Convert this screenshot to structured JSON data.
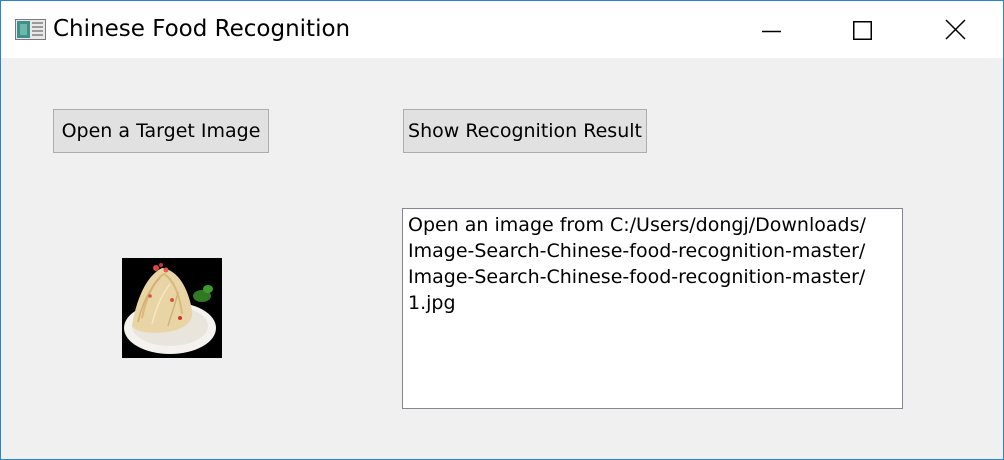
{
  "window": {
    "title": "Chinese Food Recognition",
    "border_color": "#2b83d6",
    "background_color": "#f0f0f0",
    "titlebar_icons": [
      "app-icon",
      "minimize-icon",
      "maximize-icon",
      "close-icon"
    ]
  },
  "toolbar": {
    "open_label": "Open a Target Image",
    "show_label": "Show Recognition Result"
  },
  "preview": {
    "icon": "food-image-thumbnail"
  },
  "output": {
    "lines": [
      "Open an image from C:/Users/dongj/Downloads/",
      "Image-Search-Chinese-food-recognition-master/",
      "Image-Search-Chinese-food-recognition-master/",
      "1.jpg"
    ]
  }
}
